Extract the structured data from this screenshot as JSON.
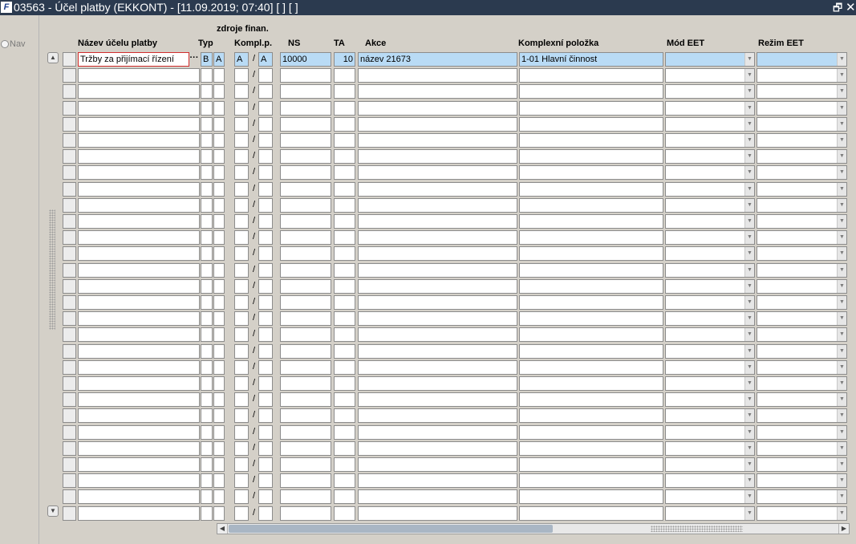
{
  "window": {
    "title": "03563 - Účel platby (EKKONT) - [11.09.2019; 07:40]  [ ]  [ ]",
    "app_icon": "F",
    "restore_glyph": "🗗",
    "close_glyph": "✕"
  },
  "left_panel": {
    "nav_label": "Nav"
  },
  "columns": {
    "zdroje": "zdroje finan.",
    "nazev": "Název účelu platby",
    "typ": "Typ",
    "kompl": "Kompl.p.",
    "ns": "NS",
    "ta": "TA",
    "akce": "Akce",
    "komplexni": "Komplexní položka",
    "mod": "Mód EET",
    "rezim": "Režim EET"
  },
  "first_row": {
    "nazev": "Tržby za přijímací řízení",
    "ellipsis": "···",
    "typ": "B",
    "typ2": "A",
    "kompl_a": "A",
    "slash": "/",
    "kompl_b": "A",
    "ns": "10000",
    "ta": "10",
    "akce": "název 21673",
    "komplexni": "1-01 Hlavní činnost",
    "mod": "",
    "rezim": ""
  },
  "empty_row_count": 28,
  "icons": {
    "scroll_up": "scroll-up-icon",
    "scroll_down": "scroll-down-icon",
    "dropdown": "chevron-down-icon"
  }
}
